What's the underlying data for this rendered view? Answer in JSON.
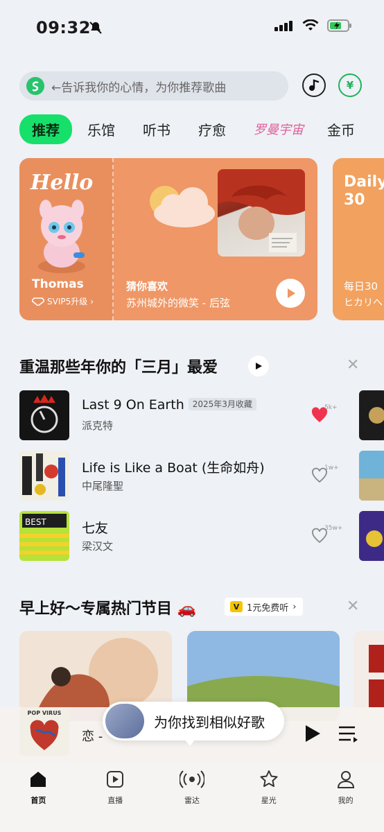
{
  "status": {
    "time": "09:32"
  },
  "search": {
    "placeholder": "←告诉我你的心情，为你推荐歌曲"
  },
  "header": {
    "coin_symbol": "¥"
  },
  "tabs": [
    {
      "label": "推荐",
      "active": true
    },
    {
      "label": "乐馆"
    },
    {
      "label": "听书"
    },
    {
      "label": "疗愈"
    },
    {
      "label": "罗曼宇宙",
      "special": true
    },
    {
      "label": "金币"
    }
  ],
  "hero": {
    "hello": "Hello",
    "user_name": "Thomas",
    "vip_label": "SVIP5升级",
    "guess_label": "猜你喜欢",
    "song": "苏州城外的微笑 - 后弦",
    "second_title_line1": "Daily",
    "second_title_line2": "30",
    "second_sub1": "每日30",
    "second_sub2": "ヒカリへ"
  },
  "section1": {
    "title": "重温那些年你的「三月」最爱",
    "songs": [
      {
        "title": "Last 9 On Earth",
        "tag": "2025年3月收藏",
        "artist": "派克特",
        "likes": "5k+",
        "liked": true
      },
      {
        "title": "Life is Like a Boat (生命如舟)",
        "tag": "",
        "artist": "中尾隆聖",
        "likes": "1w+",
        "liked": false
      },
      {
        "title": "七友",
        "tag": "",
        "artist": "梁汉文",
        "likes": "35w+",
        "liked": false
      }
    ]
  },
  "section2": {
    "title": "早上好～专属热门节目 🚗",
    "promo_label": "1元免费听",
    "promo_icon": "V"
  },
  "mini_player": {
    "cover_text": "POP VIRUS",
    "title": "恋 -",
    "bubble_text": "为你找到相似好歌"
  },
  "nav": [
    {
      "label": "首页",
      "icon": "home-icon",
      "active": true
    },
    {
      "label": "直播",
      "icon": "live-icon"
    },
    {
      "label": "雷达",
      "icon": "radar-icon"
    },
    {
      "label": "星光",
      "icon": "star-icon"
    },
    {
      "label": "我的",
      "icon": "profile-icon"
    }
  ],
  "colors": {
    "accent": "#16e06a",
    "hero": "#ef9766",
    "heart_liked": "#f0344e"
  }
}
